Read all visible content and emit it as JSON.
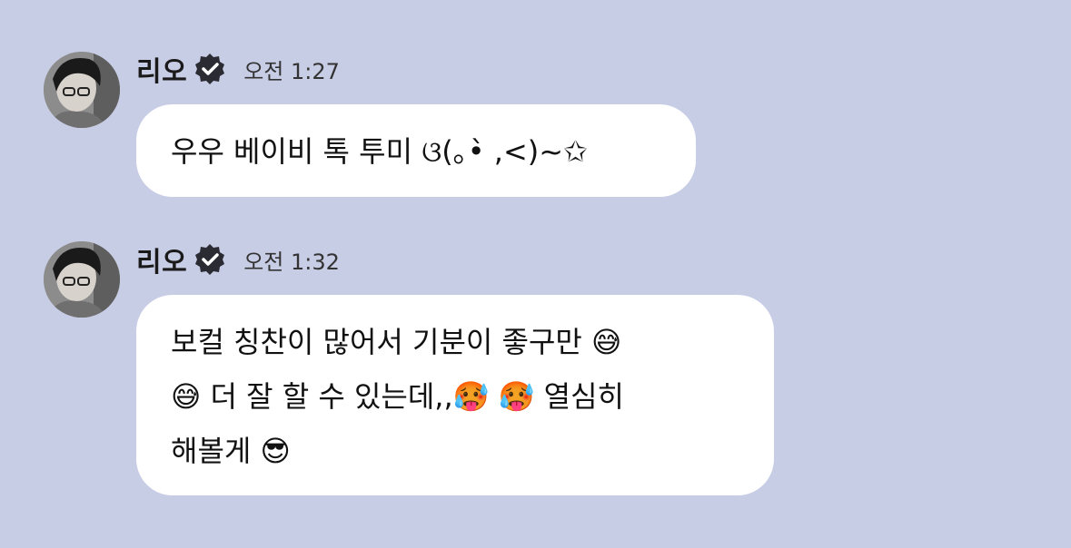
{
  "colors": {
    "background": "#c8cde6",
    "bubble": "#ffffff",
    "verified_badge": "#2b2b33"
  },
  "messages": [
    {
      "sender": "리오",
      "verified_icon": "verified-badge-icon",
      "time": "오전 1:27",
      "lines": [
        "우우 베이비 톡 투미 ଓ(｡•̀ ,<)~✩"
      ]
    },
    {
      "sender": "리오",
      "verified_icon": "verified-badge-icon",
      "time": "오전 1:32",
      "lines": [
        "보컬 칭찬이 많어서 기분이 좋구만 😅",
        "😅 더 잘 할 수 있는데,,🥵 🥵 열심히",
        "해볼게 😎"
      ]
    }
  ]
}
